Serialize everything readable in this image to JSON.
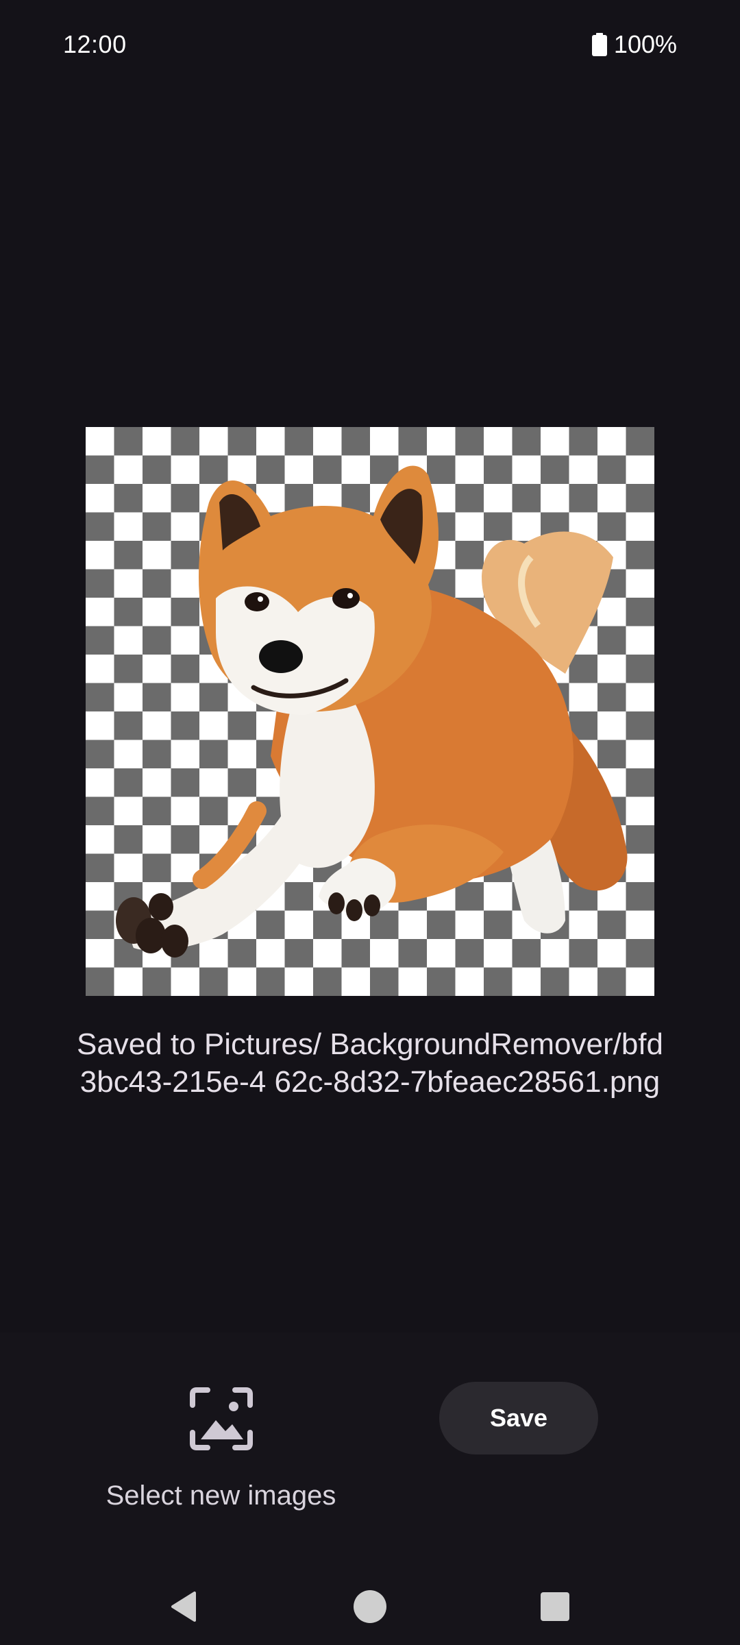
{
  "status_bar": {
    "time": "12:00",
    "battery": "100%",
    "icons": [
      "battery-icon"
    ]
  },
  "preview": {
    "subject": "dog-image",
    "background": "checkerboard-transparency"
  },
  "message": {
    "saved_text": "Saved to Pictures/ BackgroundRemover/bfd3bc43-215e-4 62c-8d32-7bfeaec28561.png"
  },
  "actions": {
    "select_images_label": "Select new images",
    "select_images_icon": "add-photo-icon",
    "save_label": "Save"
  },
  "navigation": {
    "back_icon": "back-icon",
    "home_icon": "home-icon",
    "recents_icon": "recents-icon"
  },
  "colors": {
    "background": "#141218",
    "bottom_panel": "#16141a",
    "button": "#2b292f",
    "text": "#e6e0e9",
    "checker_dark": "#6b6b6b",
    "checker_light": "#ffffff"
  }
}
